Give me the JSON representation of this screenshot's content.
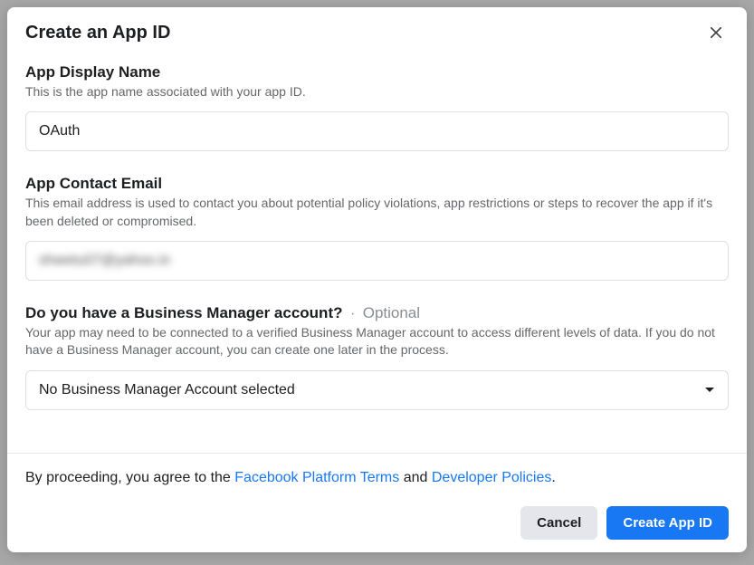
{
  "modal": {
    "title": "Create an App ID",
    "fields": {
      "display_name": {
        "label": "App Display Name",
        "description": "This is the app name associated with your app ID.",
        "value": "OAuth"
      },
      "contact_email": {
        "label": "App Contact Email",
        "description": "This email address is used to contact you about potential policy violations, app restrictions or steps to recover the app if it's been deleted or compromised.",
        "value": "shwetu07@yahoo.in"
      },
      "business_manager": {
        "label": "Do you have a Business Manager account?",
        "optional_tag": "Optional",
        "separator": "·",
        "description": "Your app may need to be connected to a verified Business Manager account to access different levels of data. If you do not have a Business Manager account, you can create one later in the process.",
        "selected": "No Business Manager Account selected"
      }
    },
    "agreement": {
      "prefix": "By proceeding, you agree to the ",
      "link1": "Facebook Platform Terms",
      "middle": " and ",
      "link2": "Developer Policies",
      "suffix": "."
    },
    "buttons": {
      "cancel": "Cancel",
      "submit": "Create App ID"
    }
  }
}
